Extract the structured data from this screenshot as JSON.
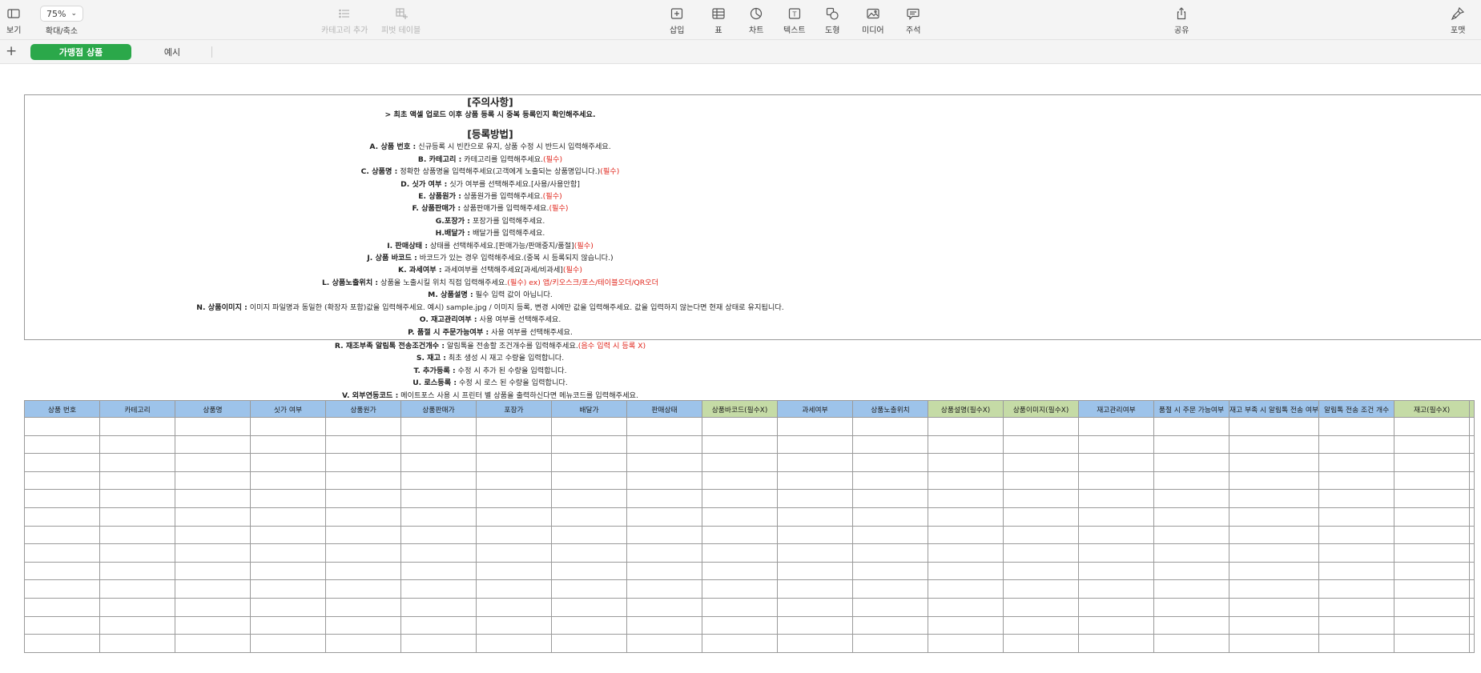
{
  "toolbar": {
    "view_label": "보기",
    "zoom_value": "75%",
    "zoom_label": "확대/축소",
    "add_category_label": "카테고리 추가",
    "pivot_label": "피벗 테이블",
    "insert_label": "삽입",
    "table_label": "표",
    "chart_label": "차트",
    "text_label": "텍스트",
    "shape_label": "도형",
    "media_label": "미디어",
    "comment_label": "주석",
    "share_label": "공유",
    "format_label": "포맷"
  },
  "sheets": {
    "active": "가맹점 상품",
    "other": "예시"
  },
  "notice": {
    "title1": "[주의사항]",
    "warn": "> 최초 액셀 업로드 이후 상품 등록 시 중복 등록인지 확인해주세요.",
    "title2": "[등록방법]",
    "lines": [
      {
        "b": "A. 상품 번호 :",
        "t": " 신규등록 시 빈칸으로 유지, 상품 수정 시 반드시 입력해주세요.",
        "r": ""
      },
      {
        "b": "B. 카테고리 :",
        "t": " 카테고리를 입력해주세요.",
        "r": "(필수)"
      },
      {
        "b": "C. 상품명 :",
        "t": " 정확한 상품명을 입력해주세요(고객에게 노출되는 상품명입니다.)",
        "r": "(필수)"
      },
      {
        "b": "D. 싯가 여부 :",
        "t": " 싯가 여부를 선택해주세요.[사용/사용안함]",
        "r": ""
      },
      {
        "b": "E. 상품원가 :",
        "t": " 상품원가를 입력해주세요.",
        "r": "(필수)"
      },
      {
        "b": "F. 상품판매가 :",
        "t": " 상품판매가를 입력해주세요.",
        "r": "(필수)"
      },
      {
        "b": "G.포장가 :",
        "t": " 포장가를 입력해주세요.",
        "r": ""
      },
      {
        "b": "H.배달가 :",
        "t": " 배달가를 입력해주세요.",
        "r": ""
      },
      {
        "b": "I. 판매상태 :",
        "t": " 상태를 선택해주세요.[판매가능/판매중지/품절]",
        "r": "(필수)"
      },
      {
        "b": "J. 상품 바코드 :",
        "t": " 바코드가 있는 경우 입력해주세요.(중복 시 등록되지 않습니다.)",
        "r": ""
      },
      {
        "b": "K. 과세여부 :",
        "t": " 과세여부를 선택해주세요[과세/비과세]",
        "r": "(필수)"
      },
      {
        "b": "L. 상품노출위치 :",
        "t": " 상품을 노출시킬 위치 직접 입력해주세요.",
        "r": "(필수) ex) 앱/키오스크/포스/테이블오더/QR오더"
      },
      {
        "b": "M. 상품설명 :",
        "t": " 필수 입력 값이 아닙니다.",
        "r": ""
      },
      {
        "b": "N. 상품이미지 :",
        "t": " 이미지 파일명과 동일한 (확장자 포함)값을 입력해주세요. 예시) sample.jpg / 이미지 등록, 변경 시에만 값을 입력해주세요. 값을 입력하지 않는다면 현재 상태로 유지됩니다.",
        "r": ""
      },
      {
        "b": "O. 재고관리여부 :",
        "t": " 사용 여부를 선택해주세요.",
        "r": ""
      },
      {
        "b": "P. 품절 시 주문가능여부 :",
        "t": " 사용 여부를 선택해주세요.",
        "r": ""
      }
    ],
    "lines2": [
      {
        "b": "R. 재조부족 알림톡 전송조건개수 :",
        "t": " 알림톡을 전송할 조건개수를 입력해주세요.",
        "r": "(음수 입력 시 등록 X)"
      },
      {
        "b": "S. 재고 :",
        "t": " 최초 생성 시 재고 수량을 입력합니다.",
        "r": ""
      },
      {
        "b": "T. 추가등록 :",
        "t": " 수정 시 추가 된 수량을 입력합니다.",
        "r": ""
      },
      {
        "b": "U. 로스등록 :",
        "t": " 수정 시 로스 된 수량을 입력합니다.",
        "r": ""
      },
      {
        "b": "V. 외부연동코드 :",
        "t": " 메이트포스 사용 시 프린터 별 상품을 출력하신다면 메뉴코드를 입력해주세요.",
        "r": ""
      }
    ]
  },
  "columns": [
    {
      "label": "상품 번호",
      "color": "#9dc3ea"
    },
    {
      "label": "카테고리",
      "color": "#9dc3ea"
    },
    {
      "label": "상품명",
      "color": "#9dc3ea"
    },
    {
      "label": "싯가 여부",
      "color": "#9dc3ea"
    },
    {
      "label": "상품원가",
      "color": "#9dc3ea"
    },
    {
      "label": "상품판매가",
      "color": "#9dc3ea"
    },
    {
      "label": "포장가",
      "color": "#9dc3ea"
    },
    {
      "label": "배달가",
      "color": "#9dc3ea"
    },
    {
      "label": "판매상태",
      "color": "#9dc3ea"
    },
    {
      "label": "상품바코드(필수X)",
      "color": "#c5dba6"
    },
    {
      "label": "과세여부",
      "color": "#9dc3ea"
    },
    {
      "label": "상품노출위치",
      "color": "#9dc3ea"
    },
    {
      "label": "상품설명(필수X)",
      "color": "#c5dba6"
    },
    {
      "label": "상품이미지(필수X)",
      "color": "#c5dba6"
    },
    {
      "label": "재고관리여부",
      "color": "#9dc3ea"
    },
    {
      "label": "품절 시 주문 가능여부",
      "color": "#9dc3ea"
    },
    {
      "label": "재고 부족 시 알림톡 전송 여부",
      "color": "#9dc3ea"
    },
    {
      "label": "알림톡 전송 조건 개수",
      "color": "#9dc3ea"
    },
    {
      "label": "재고(필수X)",
      "color": "#c5dba6"
    },
    {
      "label": "",
      "color": "#c5dba6"
    }
  ],
  "empty_rows": 13
}
